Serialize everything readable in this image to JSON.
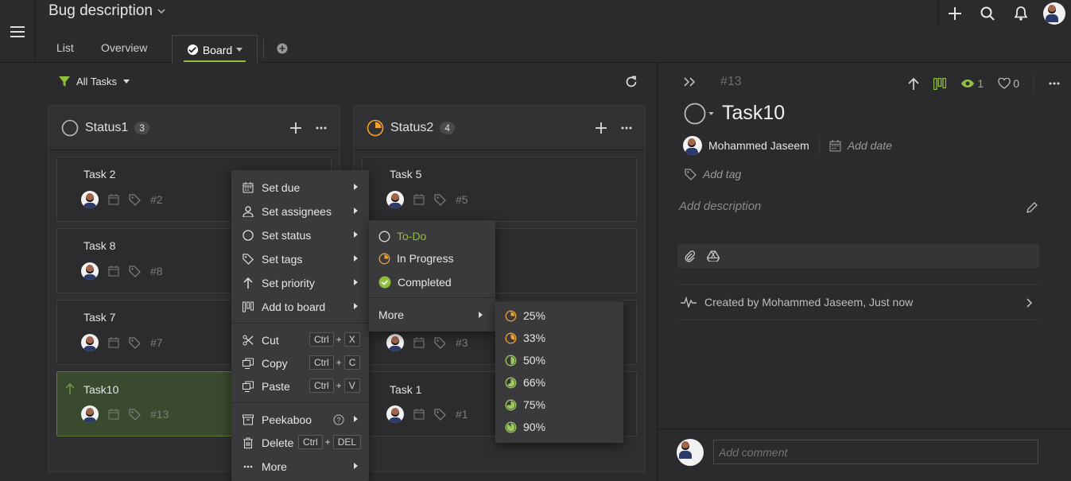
{
  "header": {
    "project_title": "Bug description",
    "tabs": {
      "list": "List",
      "overview": "Overview",
      "board": "Board"
    }
  },
  "board": {
    "filter_label": "All Tasks",
    "columns": [
      {
        "title": "Status1",
        "count": "3",
        "cards": [
          {
            "title": "Task 2",
            "id": "#2"
          },
          {
            "title": "Task 8",
            "id": "#8"
          },
          {
            "title": "Task 7",
            "id": "#7"
          },
          {
            "title": "Task10",
            "id": "#13"
          }
        ]
      },
      {
        "title": "Status2",
        "count": "4",
        "cards": [
          {
            "title": "Task 5",
            "id": "#5"
          },
          {
            "title": "",
            "id": ""
          },
          {
            "title": "",
            "id": "#3"
          },
          {
            "title": "Task 1",
            "id": "#1"
          }
        ]
      }
    ]
  },
  "context_menu": {
    "set_due": "Set due",
    "set_assignees": "Set assignees",
    "set_status": "Set status",
    "set_tags": "Set tags",
    "set_priority": "Set priority",
    "add_to_board": "Add to board",
    "cut": "Cut",
    "copy": "Copy",
    "paste": "Paste",
    "peekaboo": "Peekaboo",
    "delete": "Delete",
    "more": "More",
    "keys": {
      "ctrl": "Ctrl",
      "plus": "+",
      "x": "X",
      "c": "C",
      "v": "V",
      "del": "DEL"
    }
  },
  "status_submenu": {
    "todo": "To-Do",
    "in_progress": "In Progress",
    "completed": "Completed",
    "more": "More"
  },
  "progress_submenu": [
    "25%",
    "33%",
    "50%",
    "66%",
    "75%",
    "90%"
  ],
  "panel": {
    "task_id": "#13",
    "task_title": "Task10",
    "watchers": "1",
    "likes": "0",
    "assignee": "Mohammed Jaseem",
    "add_date": "Add date",
    "add_tag": "Add tag",
    "add_description": "Add description",
    "activity": "Created by Mohammed Jaseem, Just now",
    "comment_placeholder": "Add comment"
  },
  "colors": {
    "accent_green": "#8fbf3f",
    "in_progress_orange": "#f0a030",
    "background": "#2b2b2d"
  }
}
